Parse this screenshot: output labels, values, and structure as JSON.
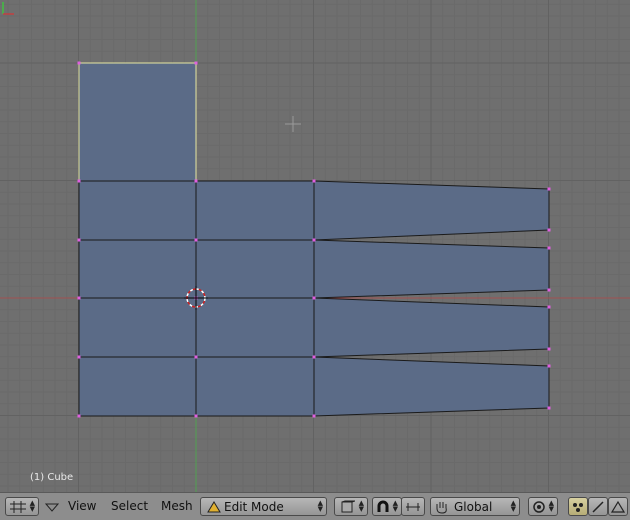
{
  "viewport": {
    "object_label": "(1) Cube",
    "background_color": "#6f6f6f",
    "grid_color": "#626262",
    "x_axis_color": "#a05050",
    "y_axis_color": "#50a050",
    "mesh_face_color": "#5b6b87",
    "mesh_edge_color": "#1a1a1a",
    "selected_edge_color": "#e7e7a0",
    "vertex_color": "#e060e0"
  },
  "header": {
    "menu_view": "View",
    "menu_select": "Select",
    "menu_mesh": "Mesh",
    "mode_label": "Edit Mode",
    "orientation_label": "Global"
  }
}
